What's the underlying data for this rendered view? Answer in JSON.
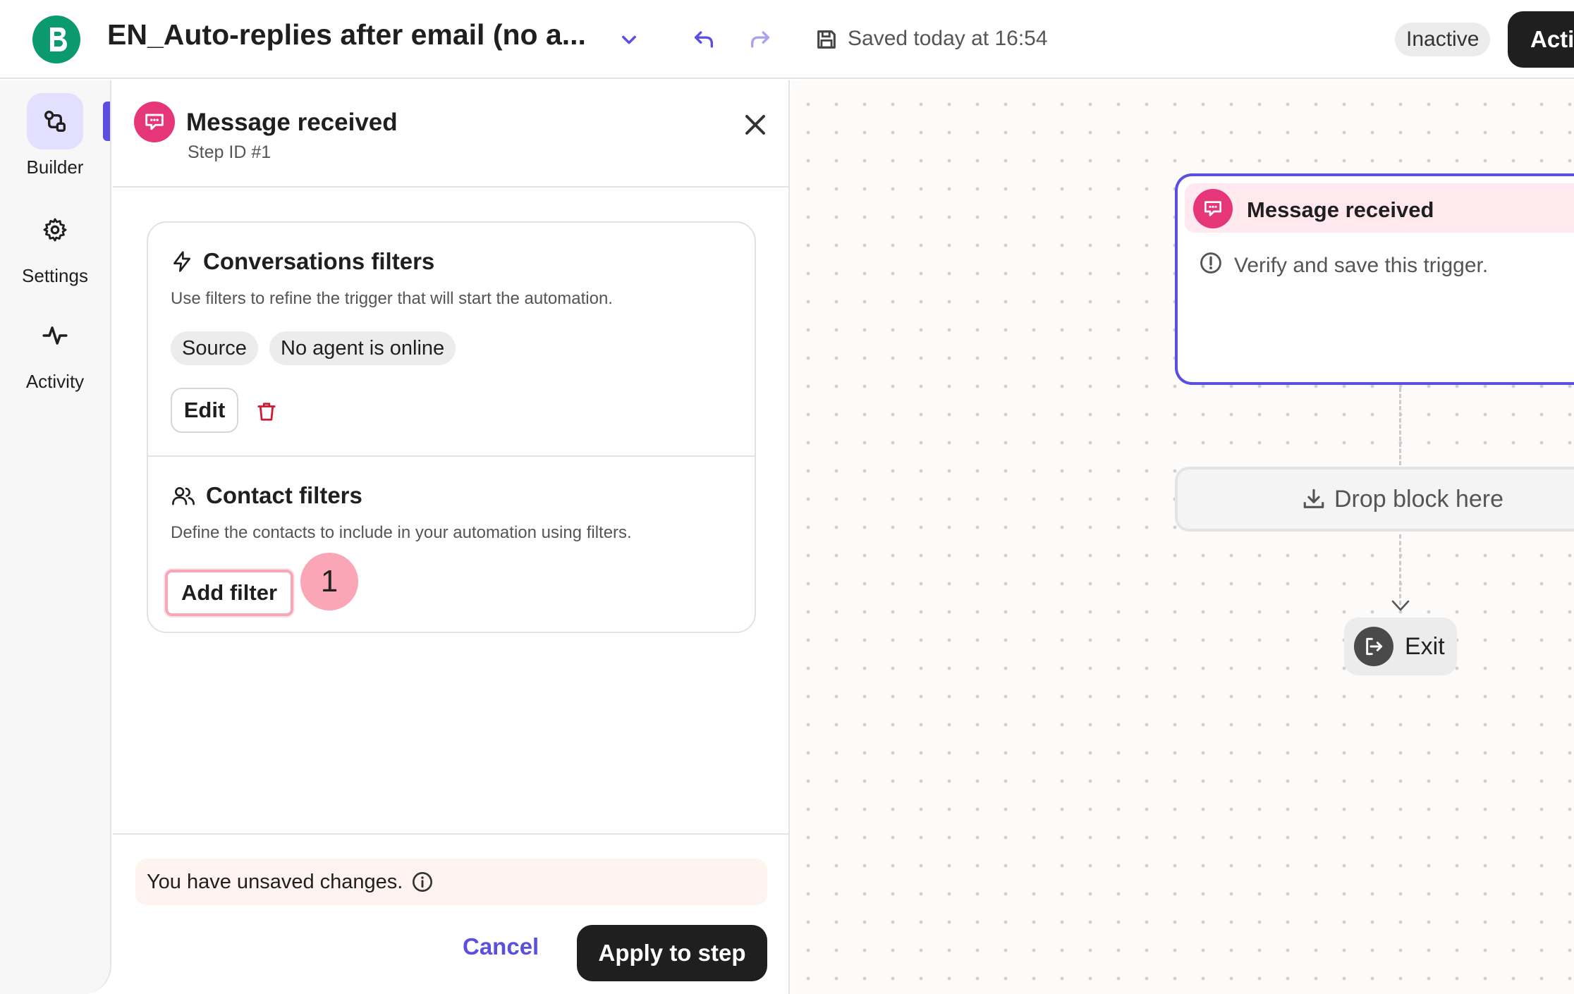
{
  "header": {
    "logo_letter": "B",
    "title": "EN_Auto-replies after email (no a...",
    "saved_text": "Saved today at 16:54",
    "status_badge": "Inactive",
    "activate_label": "Activate"
  },
  "sidebar": {
    "items": [
      {
        "label": "Builder",
        "icon": "builder-icon",
        "active": true
      },
      {
        "label": "Settings",
        "icon": "gear-icon",
        "active": false
      },
      {
        "label": "Activity",
        "icon": "activity-icon",
        "active": false
      }
    ]
  },
  "panel": {
    "title": "Message received",
    "step_id": "Step ID #1",
    "conversation_filters": {
      "title": "Conversations filters",
      "description": "Use filters to refine the trigger that will start the automation.",
      "chips": [
        "Source",
        "No agent is online"
      ],
      "edit_label": "Edit"
    },
    "contact_filters": {
      "title": "Contact filters",
      "description": "Define the contacts to include in your automation using filters.",
      "add_filter_label": "Add filter"
    },
    "step_badge": "1",
    "unsaved_text": "You have unsaved changes.",
    "cancel_label": "Cancel",
    "apply_label": "Apply to step"
  },
  "canvas": {
    "trigger_title": "Message received",
    "trigger_message": "Verify and save this trigger.",
    "drop_block_label": "Drop block here",
    "exit_label": "Exit"
  },
  "colors": {
    "accent": "#5b4fe0",
    "brand": "#0b9a6d",
    "trigger_pink": "#e6367a",
    "delete_red": "#d0192e"
  }
}
